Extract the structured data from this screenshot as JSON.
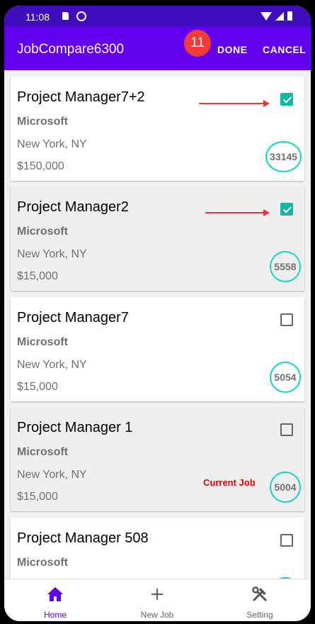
{
  "status_bar": {
    "time": "11:08"
  },
  "app_bar": {
    "title": "JobCompare6300",
    "badge": "11",
    "done_label": "DONE",
    "cancel_label": "CANCEL"
  },
  "jobs": [
    {
      "title": "Project Manager7+2",
      "company": "Microsoft",
      "location": "New York, NY",
      "salary": "$150,000",
      "score": "33145",
      "checked": true,
      "current_label": ""
    },
    {
      "title": "Project Manager2",
      "company": "Microsoft",
      "location": "New York, NY",
      "salary": "$15,000",
      "score": "5558",
      "checked": true,
      "current_label": ""
    },
    {
      "title": "Project Manager7",
      "company": "Microsoft",
      "location": "New York, NY",
      "salary": "$15,000",
      "score": "5054",
      "checked": false,
      "current_label": ""
    },
    {
      "title": "Project Manager 1",
      "company": "Microsoft",
      "location": "New York, NY",
      "salary": "$15,000",
      "score": "5004",
      "checked": false,
      "current_label": "Current Job"
    },
    {
      "title": "Project Manager 508",
      "company": "Microsoft",
      "location": "",
      "salary": "",
      "score": "",
      "checked": false,
      "current_label": ""
    }
  ],
  "bottom_nav": [
    {
      "label": "Home",
      "icon": "home-icon",
      "active": true
    },
    {
      "label": "New Job",
      "icon": "plus-icon",
      "active": false
    },
    {
      "label": "Setting",
      "icon": "tools-icon",
      "active": false
    }
  ],
  "colors": {
    "status_bar": "#3f0dbd",
    "app_bar": "#6200ee",
    "badge": "#f23a3a",
    "checkbox_checked": "#12b7a6",
    "score_ring": "#10d6c3",
    "current_job": "#e60000",
    "arrow": "#e53935"
  }
}
